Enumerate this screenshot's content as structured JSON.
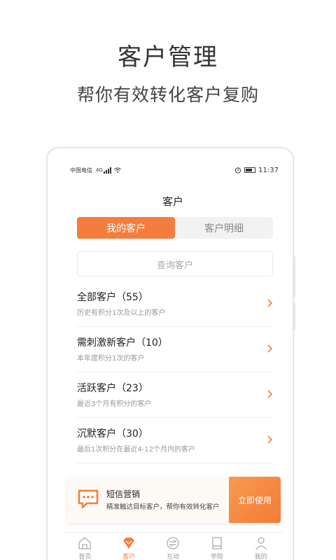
{
  "promo": {
    "title": "客户管理",
    "subtitle": "帮你有效转化客户复购"
  },
  "status_bar": {
    "carrier": "中国电信",
    "network": "4G",
    "time": "11:37"
  },
  "screen": {
    "title": "客户"
  },
  "segment": {
    "tabs": [
      {
        "label": "我的客户",
        "active": true
      },
      {
        "label": "客户明细",
        "active": false
      }
    ]
  },
  "search": {
    "placeholder": "查询客户"
  },
  "customer_groups": [
    {
      "title": "全部客户（55）",
      "desc": "历史有积分1次及以上的客户"
    },
    {
      "title": "需刺激新客户（10）",
      "desc": "本年度积分1次的客户"
    },
    {
      "title": "活跃客户（23）",
      "desc": "最近3个月有积分的客户"
    },
    {
      "title": "沉默客户（30）",
      "desc": "最后1次积分在最近4-12个月内的客户"
    }
  ],
  "sms_banner": {
    "title": "短信营销",
    "desc": "精准触达目标客户，帮你有效转化客户",
    "cta": "立即使用"
  },
  "tabbar": {
    "items": [
      {
        "label": "首页",
        "icon": "home-icon",
        "active": false
      },
      {
        "label": "客户",
        "icon": "diamond-icon",
        "active": true
      },
      {
        "label": "互动",
        "icon": "exchange-icon",
        "active": false
      },
      {
        "label": "学院",
        "icon": "book-icon",
        "active": false
      },
      {
        "label": "我的",
        "icon": "user-icon",
        "active": false
      }
    ]
  },
  "colors": {
    "accent": "#f47d3d",
    "text": "#333333",
    "muted": "#999999"
  }
}
